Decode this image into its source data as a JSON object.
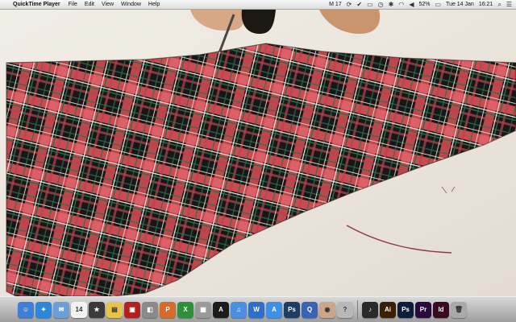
{
  "menubar": {
    "app_name": "QuickTime Player",
    "menus": [
      "File",
      "Edit",
      "View",
      "Window",
      "Help"
    ],
    "status": {
      "mail": "M 17",
      "battery": "52%",
      "date": "Tue 14 Jan",
      "time": "16:21"
    }
  },
  "dock": {
    "items": [
      {
        "name": "finder",
        "glyph": "☺",
        "color": "#3f7fd6"
      },
      {
        "name": "safari",
        "glyph": "✦",
        "color": "#2e86d6"
      },
      {
        "name": "mail",
        "glyph": "✉",
        "color": "#6a9fd8"
      },
      {
        "name": "calendar",
        "glyph": "14",
        "color": "#f2f2f2"
      },
      {
        "name": "imovie",
        "glyph": "★",
        "color": "#3a3a3a"
      },
      {
        "name": "stickies",
        "glyph": "▤",
        "color": "#e6c34a"
      },
      {
        "name": "photobooth",
        "glyph": "▣",
        "color": "#b32020"
      },
      {
        "name": "preview",
        "glyph": "◧",
        "color": "#8a8a8a"
      },
      {
        "name": "powerpoint",
        "glyph": "P",
        "color": "#d86a2b"
      },
      {
        "name": "excel",
        "glyph": "X",
        "color": "#2f8f3a"
      },
      {
        "name": "calculator",
        "glyph": "▦",
        "color": "#9a9a9a"
      },
      {
        "name": "illustrator-a",
        "glyph": "A",
        "color": "#1c1c1c"
      },
      {
        "name": "itunes",
        "glyph": "♫",
        "color": "#4a8fe0"
      },
      {
        "name": "word",
        "glyph": "W",
        "color": "#2f6fc8"
      },
      {
        "name": "app-store",
        "glyph": "A",
        "color": "#3d8fe8"
      },
      {
        "name": "photoshop",
        "glyph": "Ps",
        "color": "#1d3d66"
      },
      {
        "name": "quicktime",
        "glyph": "Q",
        "color": "#3a63b0"
      },
      {
        "name": "photo",
        "glyph": "◉",
        "color": "#c9a88a"
      },
      {
        "name": "help",
        "glyph": "?",
        "color": "#b8b8b8"
      },
      {
        "name": "sep1",
        "glyph": "",
        "color": ""
      },
      {
        "name": "music",
        "glyph": "♪",
        "color": "#2a2a2a"
      },
      {
        "name": "illustrator",
        "glyph": "Ai",
        "color": "#3b1f05"
      },
      {
        "name": "photoshop-2",
        "glyph": "Ps",
        "color": "#0c1d3a"
      },
      {
        "name": "premiere",
        "glyph": "Pr",
        "color": "#2a0a3a"
      },
      {
        "name": "indesign",
        "glyph": "Id",
        "color": "#3a0a22"
      },
      {
        "name": "trash",
        "glyph": "🗑",
        "color": "#a9a9a9"
      }
    ]
  },
  "colors": {
    "tartan_red": "#c94c52",
    "tartan_dark": "#161618",
    "carpet": "#ebe6dd"
  }
}
